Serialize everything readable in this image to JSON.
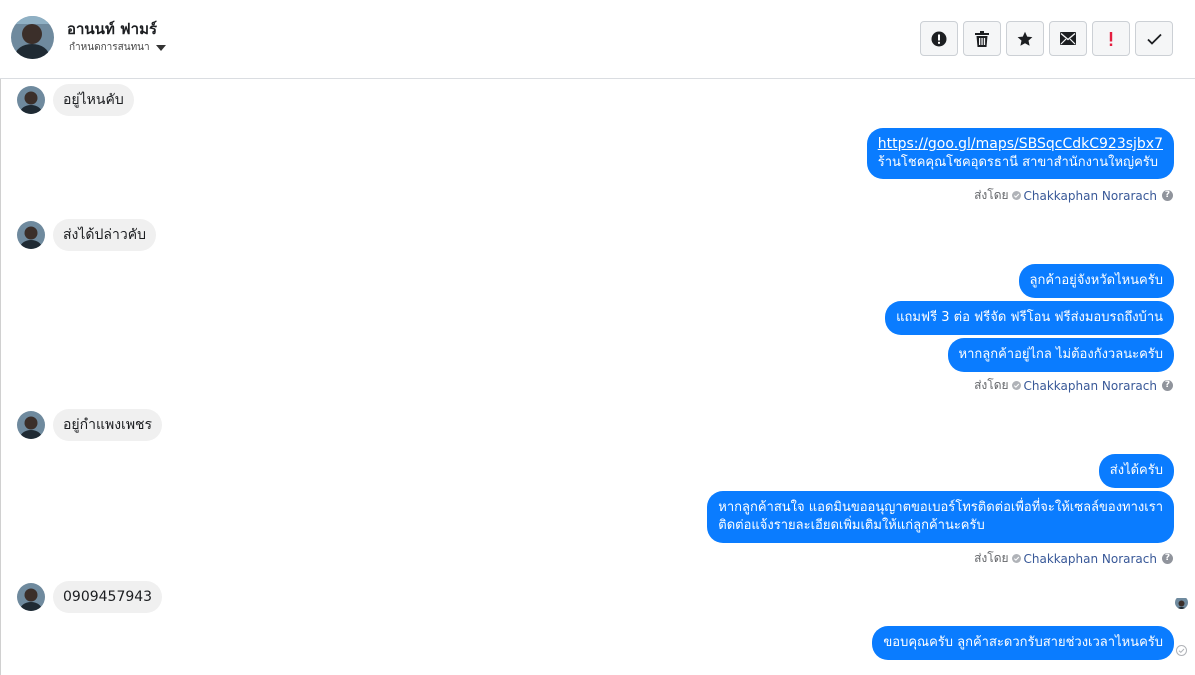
{
  "header": {
    "contact_name": "อานนท์ ฟามร์",
    "subtitle": "กำหนดการสนทนา"
  },
  "toolbar": {
    "buttons": [
      {
        "name": "report-spam",
        "icon": "alert-circle-icon"
      },
      {
        "name": "delete",
        "icon": "trash-icon"
      },
      {
        "name": "star",
        "icon": "star-icon"
      },
      {
        "name": "mark-unread",
        "icon": "envelope-icon"
      },
      {
        "name": "follow-up",
        "icon": "exclamation-icon"
      },
      {
        "name": "mark-done",
        "icon": "checkmark-icon"
      }
    ]
  },
  "messages": {
    "in1": "อยู่ไหนคับ",
    "out1_link": "https://goo.gl/maps/SBSqcCdkC923sjbx7",
    "out1_text": "ร้านโชคคุณโชคอุดรธานี สาขาสำนักงานใหญ่ครับ",
    "in2": "ส่งได้ปล่าวคับ",
    "out2": "ลูกค้าอยู่จังหวัดไหนครับ",
    "out3": "แถมฟรี 3 ต่อ ฟรีจัด ฟรีโอน  ฟรีส่งมอบรถถึงบ้าน",
    "out4": "หากลูกค้าอยู่ไกล ไม่ต้องกังวลนะครับ",
    "in3": "อยู่กำแพงเพชร",
    "out5": "ส่งได้ครับ",
    "out6_line1": "หากลูกค้าสนใจ แอดมินขออนุญาตขอเบอร์โทรติดต่อเพื่อที่จะให้เซลล์ของทางเรา",
    "out6_line2": "ติดต่อแจ้งรายละเอียดเพิ่มเติมให้แก่ลูกค้านะครับ",
    "in4": "0909457943",
    "out7": "ขอบคุณครับ ลูกค้าสะดวกรับสายช่วงเวลาไหนครับ"
  },
  "sent_by": {
    "prefix": "ส่งโดย",
    "agent": "Chakkaphan Norarach",
    "help_glyph": "?"
  },
  "colors": {
    "outgoing_bubble": "#0a7cff",
    "incoming_bubble": "#f0f0f0",
    "agent_link": "#385898"
  }
}
